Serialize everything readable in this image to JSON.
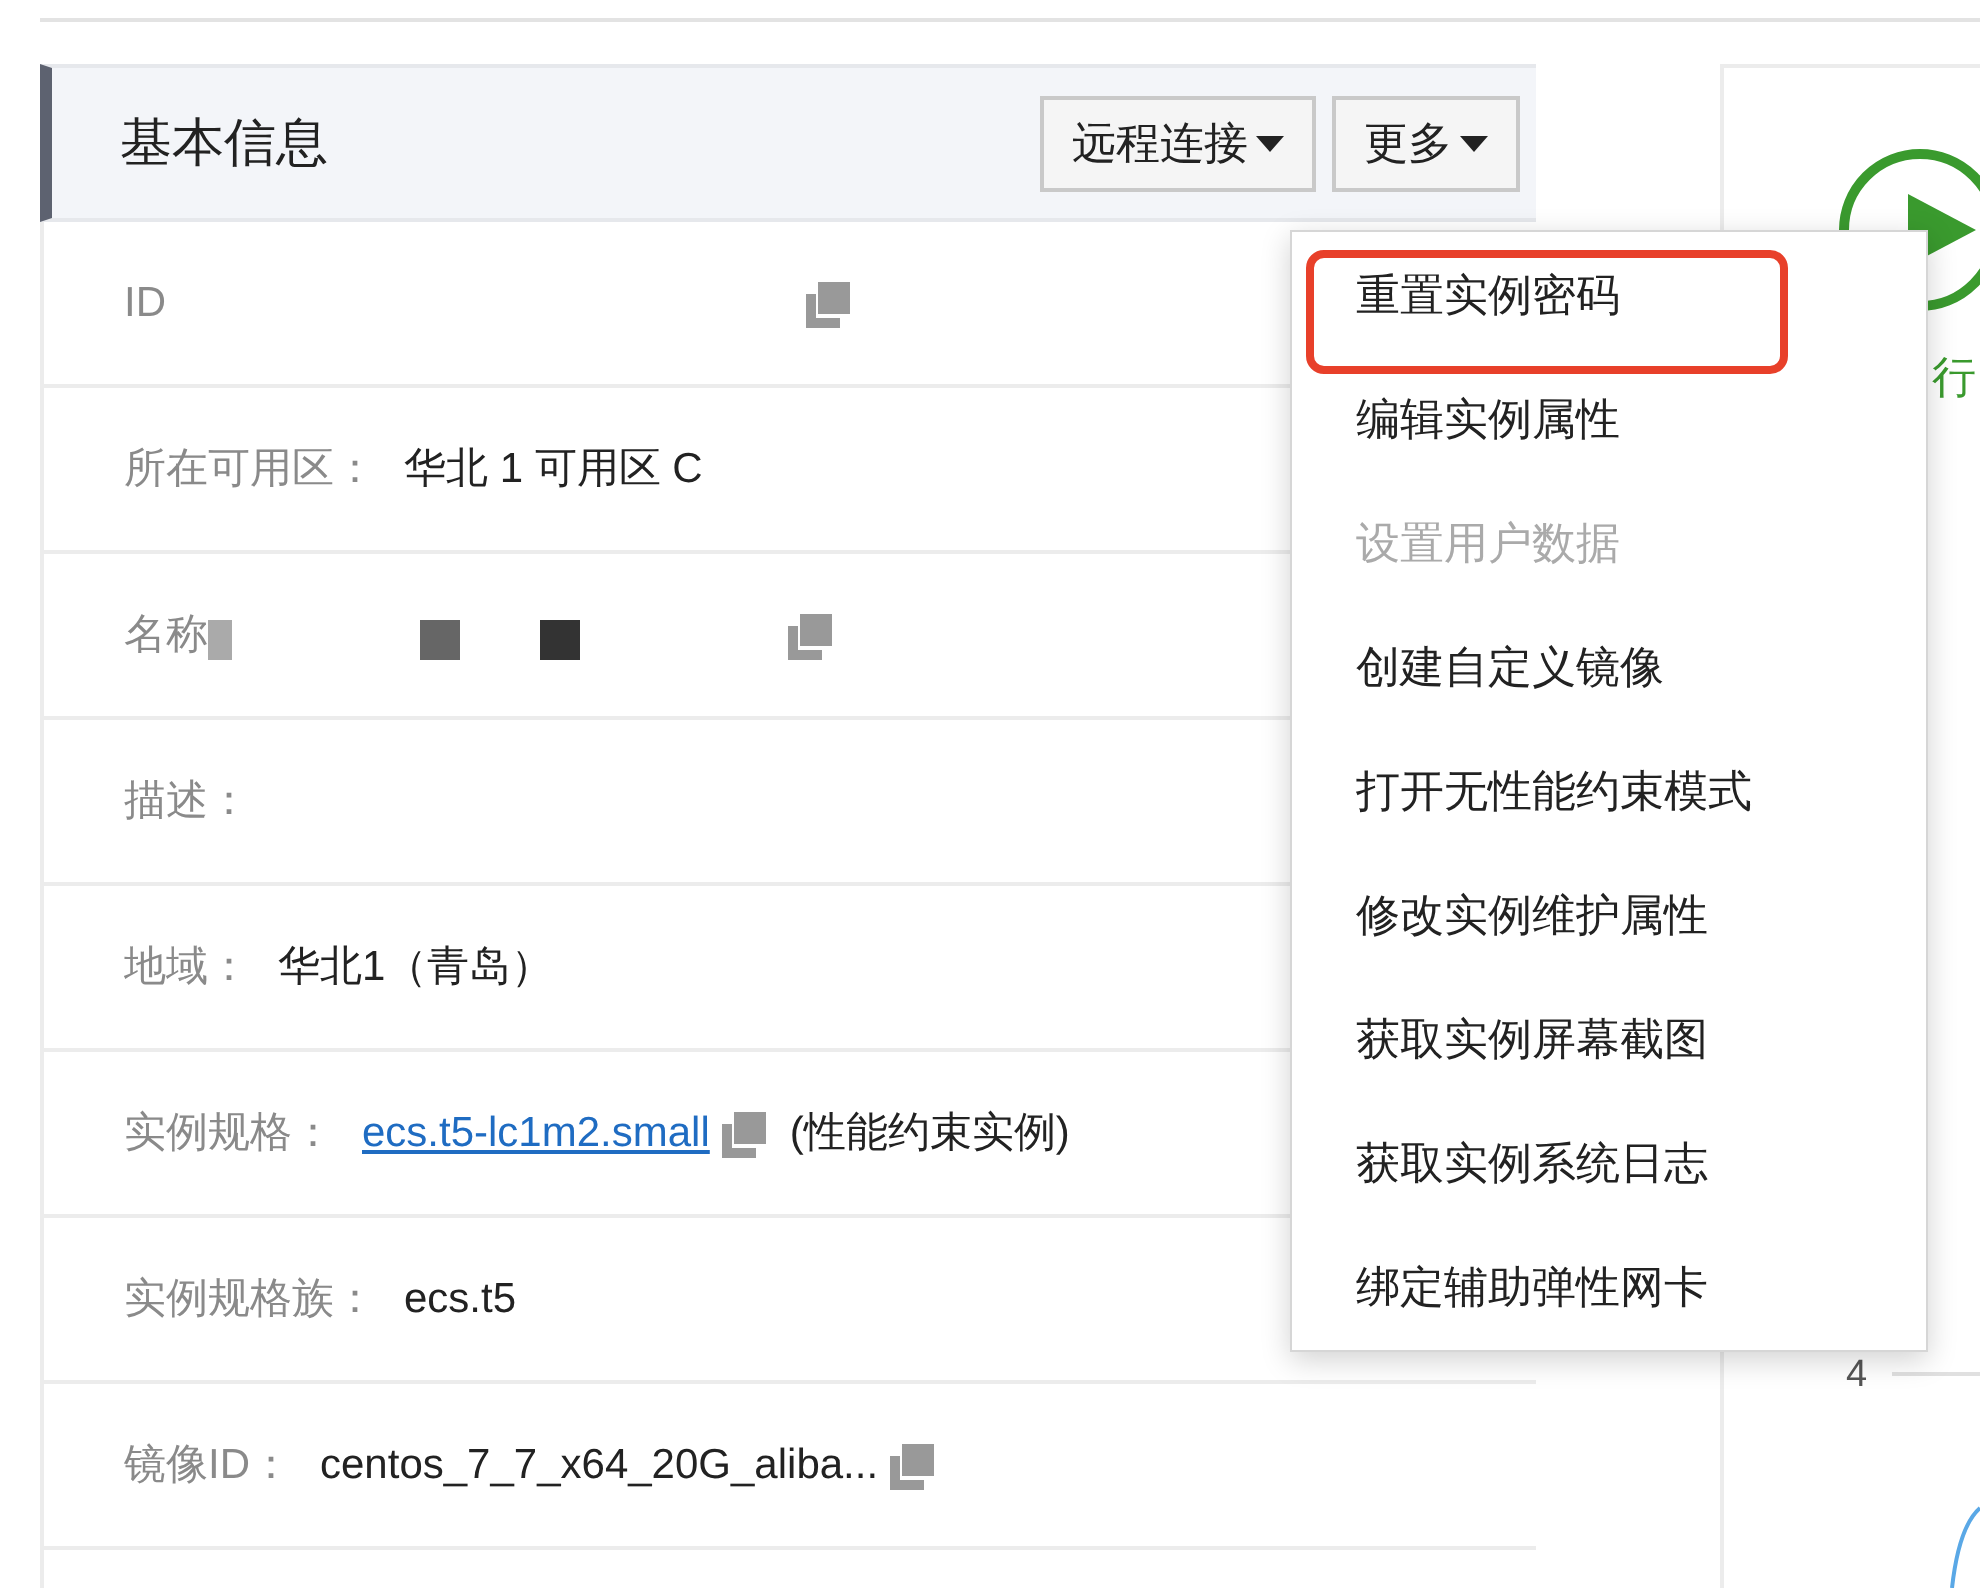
{
  "panel": {
    "title": "基本信息",
    "buttons": [
      {
        "label": "远程连接"
      },
      {
        "label": "更多"
      }
    ]
  },
  "fields": [
    {
      "kind": "redacted",
      "label": "ID",
      "copy": true
    },
    {
      "kind": "text",
      "label": "所在可用区：",
      "value": "华北 1 可用区 C"
    },
    {
      "kind": "redacted",
      "label": "名称",
      "copy": true
    },
    {
      "kind": "text",
      "label": "描述："
    },
    {
      "kind": "text",
      "label": "地域：",
      "value": "华北1（青岛）"
    },
    {
      "kind": "link",
      "label": "实例规格：",
      "value": "ecs.t5-lc1m2.small",
      "copy": true,
      "note": "(性能约束实例)"
    },
    {
      "kind": "text",
      "label": "实例规格族：",
      "value": "ecs.t5"
    },
    {
      "kind": "text",
      "label": "镜像ID：",
      "value": "centos_7_7_x64_20G_aliba...",
      "copy": true
    }
  ],
  "menu": [
    {
      "label": "重置实例密码",
      "disabled": false,
      "highlighted": true
    },
    {
      "label": "编辑实例属性",
      "disabled": false,
      "highlighted": false
    },
    {
      "label": "设置用户数据",
      "disabled": true,
      "highlighted": false
    },
    {
      "label": "创建自定义镜像",
      "disabled": false,
      "highlighted": false
    },
    {
      "label": "打开无性能约束模式",
      "disabled": false,
      "highlighted": false
    },
    {
      "label": "修改实例维护属性",
      "disabled": false,
      "highlighted": false
    },
    {
      "label": "获取实例屏幕截图",
      "disabled": false,
      "highlighted": false
    },
    {
      "label": "获取实例系统日志",
      "disabled": false,
      "highlighted": false
    },
    {
      "label": "绑定辅助弹性网卡",
      "disabled": false,
      "highlighted": false
    }
  ],
  "status": {
    "text": "行",
    "axis_tick": "4"
  }
}
